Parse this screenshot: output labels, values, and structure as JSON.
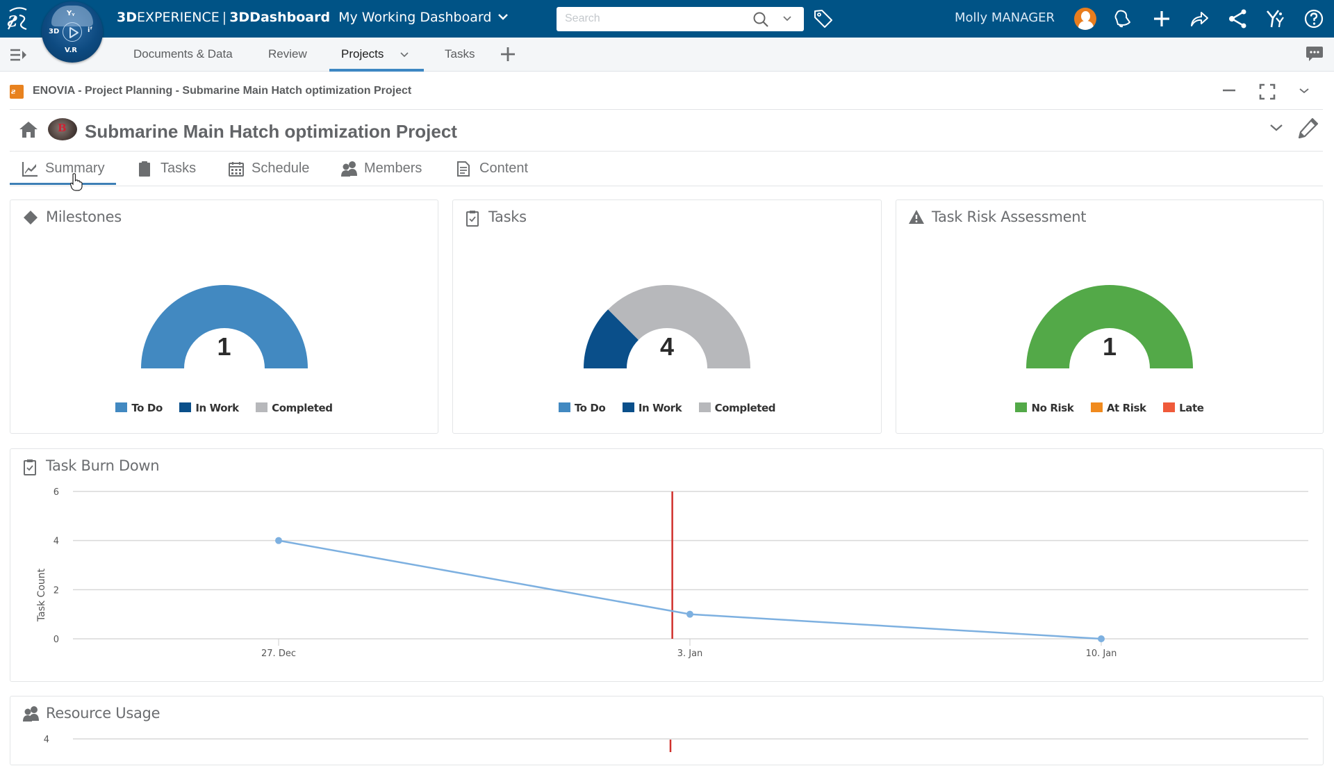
{
  "topbar": {
    "brand_bold": "3D",
    "brand_light": "EXPERIENCE",
    "separator": "|",
    "app_name": "3DDashboard",
    "dashboard_name": "My Working Dashboard",
    "search_placeholder": "Search",
    "search_value": "",
    "user_name": "Molly MANAGER",
    "compass_labels": {
      "top": "Yᵧ",
      "left": "3D",
      "right": "iᶠ",
      "bottom": "V.R"
    },
    "icons": [
      "notifications-icon",
      "add-icon",
      "share-icon",
      "social-share-icon",
      "community-icon",
      "help-icon"
    ]
  },
  "dashboard_tabs": [
    {
      "label": "Documents & Data",
      "active": false
    },
    {
      "label": "Review",
      "active": false
    },
    {
      "label": "Projects",
      "active": true,
      "has_menu": true
    },
    {
      "label": "Tasks",
      "active": false
    }
  ],
  "widget": {
    "title": "ENOVIA - Project Planning - Submarine Main Hatch optimization Project",
    "project_title": "Submarine Main Hatch optimization Project",
    "tabs": [
      {
        "label": "Summary",
        "icon": "chart-line-icon",
        "active": true
      },
      {
        "label": "Tasks",
        "icon": "clipboard-icon",
        "active": false
      },
      {
        "label": "Schedule",
        "icon": "calendar-icon",
        "active": false
      },
      {
        "label": "Members",
        "icon": "users-icon",
        "active": false
      },
      {
        "label": "Content",
        "icon": "document-icon",
        "active": false
      }
    ]
  },
  "colors": {
    "topbar": "#005386",
    "todo": "#4289c1",
    "in_work": "#0a4f8a",
    "completed": "#b7b8bb",
    "no_risk": "#53a948",
    "at_risk": "#f08a1e",
    "late": "#ef5a3a",
    "burn_line": "#7db0e0",
    "today_line": "#d0312d"
  },
  "chart_data": [
    {
      "type": "pie",
      "variant": "semi-donut",
      "title": "Milestones",
      "total": 1,
      "categories": [
        "To Do",
        "In Work",
        "Completed"
      ],
      "values": [
        1,
        0,
        0
      ]
    },
    {
      "type": "pie",
      "variant": "semi-donut",
      "title": "Tasks",
      "total": 4,
      "categories": [
        "To Do",
        "In Work",
        "Completed"
      ],
      "values": [
        0,
        1,
        3
      ]
    },
    {
      "type": "pie",
      "variant": "semi-donut",
      "title": "Task Risk Assessment",
      "total": 1,
      "categories": [
        "No Risk",
        "At Risk",
        "Late"
      ],
      "values": [
        1,
        0,
        0
      ]
    },
    {
      "type": "line",
      "title": "Task Burn Down",
      "xlabel": "",
      "ylabel": "Task Count",
      "x": [
        "27. Dec",
        "3. Jan",
        "10. Jan"
      ],
      "x_days": [
        0,
        7,
        14
      ],
      "series": [
        {
          "name": "Task Count",
          "values": [
            4,
            1,
            0
          ]
        }
      ],
      "ylim": [
        0,
        6
      ],
      "yticks": [
        0,
        2,
        4,
        6
      ],
      "today_marker_day": 6.7,
      "grid": true
    },
    {
      "type": "line",
      "title": "Resource Usage",
      "yticks_visible": [
        4
      ],
      "partial": true
    }
  ]
}
